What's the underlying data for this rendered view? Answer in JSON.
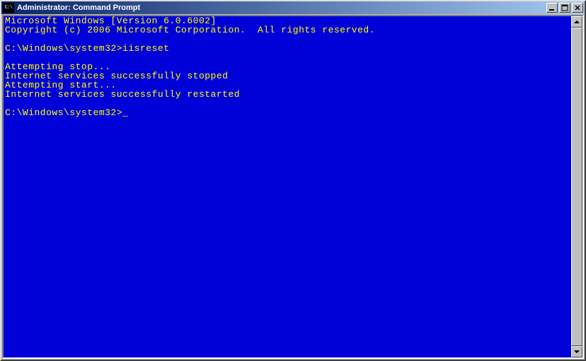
{
  "titlebar": {
    "icon_text": "C:\\",
    "title": "Administrator: Command Prompt"
  },
  "console": {
    "line1": "Microsoft Windows [Version 6.0.6002]",
    "line2": "Copyright (c) 2006 Microsoft Corporation.  All rights reserved.",
    "blank1": "",
    "prompt1": "C:\\Windows\\system32>",
    "command1": "iisreset",
    "blank2": "",
    "out1": "Attempting stop...",
    "out2": "Internet services successfully stopped",
    "out3": "Attempting start...",
    "out4": "Internet services successfully restarted",
    "blank3": "",
    "prompt2": "C:\\Windows\\system32>",
    "cursor": "_"
  }
}
